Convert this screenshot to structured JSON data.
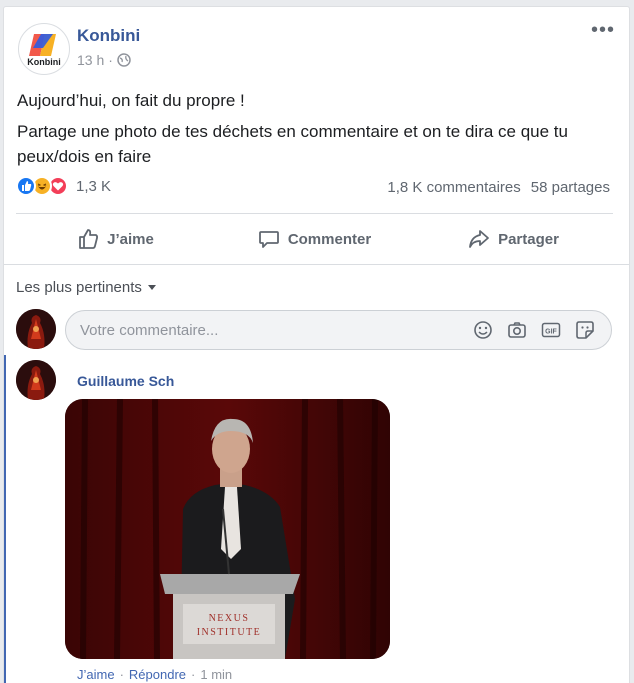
{
  "post": {
    "page_name": "Konbini",
    "logo_text": "Konbini",
    "time": "13 h",
    "separator": "·",
    "text_line1": "Aujourd’hui, on fait du propre !",
    "text_line2": "Partage une photo de tes déchets en commentaire et on te dira ce que tu peux/dois en faire"
  },
  "reactions": {
    "icons": [
      "like-icon",
      "haha-icon",
      "love-icon"
    ],
    "count": "1,3 K",
    "comments": "1,8 K commentaires",
    "shares": "58 partages"
  },
  "actions": {
    "like": "J’aime",
    "comment": "Commenter",
    "share": "Partager"
  },
  "comments": {
    "sort_label": "Les plus pertinents",
    "input_placeholder": "Votre commentaire...",
    "box_icons": [
      "emoji-icon",
      "camera-icon",
      "gif-icon",
      "sticker-icon"
    ],
    "items": [
      {
        "author": "Guillaume Sch",
        "photo_text_1": "NEXUS",
        "photo_text_2": "INSTITUTE",
        "like": "J’aime",
        "reply": "Répondre",
        "time": "1 min",
        "sep": "·"
      }
    ]
  },
  "colors": {
    "link": "#385898",
    "accent": "#4267b2",
    "muted": "#606770"
  }
}
